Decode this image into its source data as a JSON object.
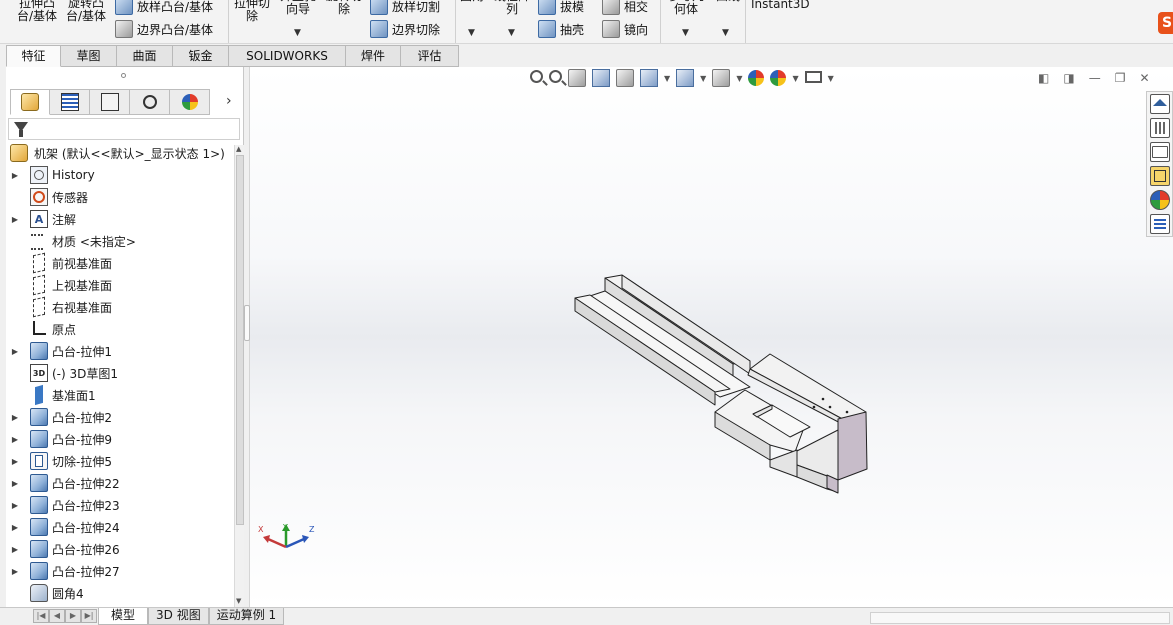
{
  "ribbon": {
    "extrude_boss": "拉伸凸\n台/基体",
    "revolve_boss": "旋转凸\n台/基体",
    "loft_boss": "放样凸台/基体",
    "boundary_boss": "边界凸台/基体",
    "extrude_cut": "拉伸切\n除",
    "hole_wizard": "异型孔\n向导",
    "revolve_cut": "旋转切\n除",
    "loft_cut": "放样切割",
    "boundary_cut": "边界切除",
    "fillet": "圆角",
    "linear_pattern": "线性阵\n列",
    "draft": "拔模",
    "intersect": "相交",
    "shell": "抽壳",
    "mirror": "镜向",
    "reference_geometry": "参考几\n何体",
    "curves": "曲线",
    "instant3d": "Instant3D"
  },
  "command_tabs": [
    "特征",
    "草图",
    "曲面",
    "钣金",
    "SOLIDWORKS MBD",
    "焊件(D)",
    "评估"
  ],
  "feature_tree": {
    "root_label": "机架 (默认<<默认>_显示状态 1>)",
    "items": [
      {
        "label": "History",
        "icon": "history-icon",
        "expandable": true
      },
      {
        "label": "传感器",
        "icon": "sensor-icon",
        "expandable": false
      },
      {
        "label": "注解",
        "icon": "annotation-icon",
        "expandable": true
      },
      {
        "label": "材质 <未指定>",
        "icon": "material-icon",
        "expandable": false
      },
      {
        "label": "前视基准面",
        "icon": "plane-icon",
        "expandable": false
      },
      {
        "label": "上视基准面",
        "icon": "plane-icon",
        "expandable": false
      },
      {
        "label": "右视基准面",
        "icon": "plane-icon",
        "expandable": false
      },
      {
        "label": "原点",
        "icon": "origin-icon",
        "expandable": false
      },
      {
        "label": "凸台-拉伸1",
        "icon": "extrude-boss-icon",
        "expandable": true
      },
      {
        "label": "(-) 3D草图1",
        "icon": "sketch-3d-icon",
        "expandable": false
      },
      {
        "label": "基准面1",
        "icon": "reference-plane-icon",
        "expandable": false
      },
      {
        "label": "凸台-拉伸2",
        "icon": "extrude-boss-icon",
        "expandable": true
      },
      {
        "label": "凸台-拉伸9",
        "icon": "extrude-boss-icon",
        "expandable": true
      },
      {
        "label": "切除-拉伸5",
        "icon": "extrude-cut-icon",
        "expandable": true
      },
      {
        "label": "凸台-拉伸22",
        "icon": "extrude-boss-icon",
        "expandable": true
      },
      {
        "label": "凸台-拉伸23",
        "icon": "extrude-boss-icon",
        "expandable": true
      },
      {
        "label": "凸台-拉伸24",
        "icon": "extrude-boss-icon",
        "expandable": true
      },
      {
        "label": "凸台-拉伸26",
        "icon": "extrude-boss-icon",
        "expandable": true
      },
      {
        "label": "凸台-拉伸27",
        "icon": "extrude-boss-icon",
        "expandable": true
      },
      {
        "label": "圆角4",
        "icon": "fillet-icon",
        "expandable": false
      }
    ]
  },
  "triad": {
    "x": "X",
    "y": "Y",
    "z": "Z"
  },
  "bottom_tabs": [
    "模型",
    "3D 视图",
    "运动算例 1"
  ],
  "colors": {
    "accent": "#2c5fb8",
    "model_face": "#f2f2f2",
    "model_shade": "#c7bcc9",
    "model_edge": "#222222"
  }
}
